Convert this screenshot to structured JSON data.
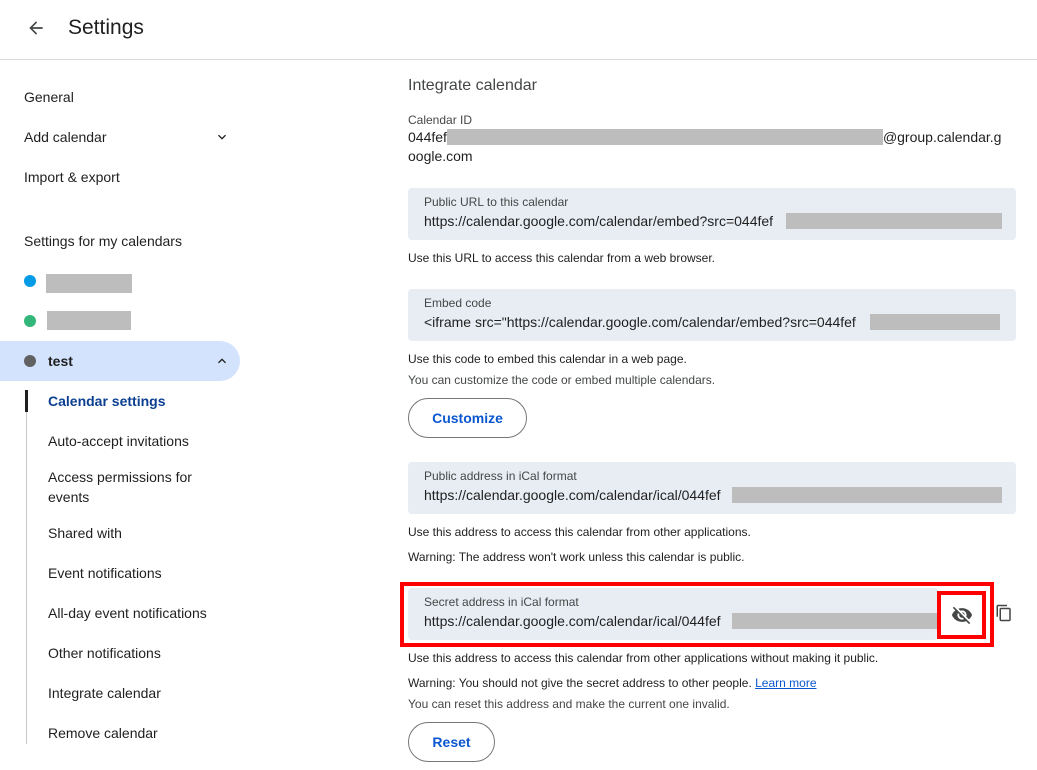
{
  "header": {
    "title": "Settings",
    "back_icon": "arrow-back-icon"
  },
  "sidebar": {
    "general": "General",
    "add_calendar": "Add calendar",
    "import_export": "Import & export",
    "section_heading": "Settings for my calendars",
    "calendars": [
      {
        "name": "",
        "color": "#039be5",
        "redacted": true
      },
      {
        "name": "",
        "color": "#33b679",
        "redacted": true
      },
      {
        "name": "test",
        "color": "#616161",
        "redacted": false
      }
    ],
    "sub_items": [
      "Calendar settings",
      "Auto-accept invitations",
      "Access permissions for events",
      "Shared with",
      "Event notifications",
      "All-day event notifications",
      "Other notifications",
      "Integrate calendar",
      "Remove calendar"
    ]
  },
  "main": {
    "section_title": "Integrate calendar",
    "calendar_id": {
      "label": "Calendar ID",
      "prefix": "044fef",
      "suffix": "@group.calendar.g",
      "line2": "oogle.com"
    },
    "public_url": {
      "label": "Public URL to this calendar",
      "value": "https://calendar.google.com/calendar/embed?src=044fef",
      "helper": "Use this URL to access this calendar from a web browser."
    },
    "embed_code": {
      "label": "Embed code",
      "value": "<iframe src=\"https://calendar.google.com/calendar/embed?src=044fef",
      "helper1": "Use this code to embed this calendar in a web page.",
      "helper2": "You can customize the code or embed multiple calendars.",
      "customize_label": "Customize"
    },
    "public_ical": {
      "label": "Public address in iCal format",
      "value": "https://calendar.google.com/calendar/ical/044fef",
      "helper1": "Use this address to access this calendar from other applications.",
      "helper2": "Warning: The address won't work unless this calendar is public."
    },
    "secret_ical": {
      "label": "Secret address in iCal format",
      "value": "https://calendar.google.com/calendar/ical/044fef",
      "helper1": "Use this address to access this calendar from other applications without making it public.",
      "helper2": "Warning: You should not give the secret address to other people.",
      "learn_more": "Learn more",
      "helper3": "You can reset this address and make the current one invalid.",
      "reset_label": "Reset",
      "visibility_icon": "visibility-off-icon",
      "copy_icon": "copy-icon"
    }
  },
  "colors": {
    "accent": "#0b57d0",
    "active_bg": "#d3e3fd",
    "field_bg": "#e8edf4",
    "highlight": "#ff0000"
  }
}
